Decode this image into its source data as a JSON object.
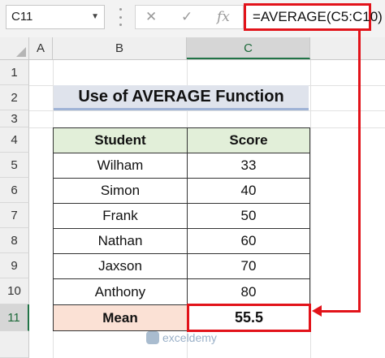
{
  "name_box": {
    "value": "C11",
    "dropdown": "▼"
  },
  "formula_bar": {
    "cancel_icon": "✕",
    "enter_icon": "✓",
    "fx_label": "fx",
    "formula": "=AVERAGE(C5:C10)"
  },
  "columns": [
    "A",
    "B",
    "C"
  ],
  "selected_column": "C",
  "rows": [
    "1",
    "2",
    "3",
    "4",
    "5",
    "6",
    "7",
    "8",
    "9",
    "10",
    "11"
  ],
  "selected_row": "11",
  "title": "Use of AVERAGE Function",
  "table": {
    "headers": [
      "Student",
      "Score"
    ],
    "rows": [
      {
        "student": "Wilham",
        "score": "33"
      },
      {
        "student": "Simon",
        "score": "40"
      },
      {
        "student": "Frank",
        "score": "50"
      },
      {
        "student": "Nathan",
        "score": "60"
      },
      {
        "student": "Jaxson",
        "score": "70"
      },
      {
        "student": "Anthony",
        "score": "80"
      }
    ],
    "mean_label": "Mean",
    "mean_value": "55.5"
  },
  "watermark": "exceldemy",
  "colors": {
    "highlight_red": "#e2131a",
    "header_green": "#e2efd9",
    "mean_peach": "#fbe1d5",
    "title_bg": "#dfe3ec",
    "excel_green": "#217346"
  }
}
